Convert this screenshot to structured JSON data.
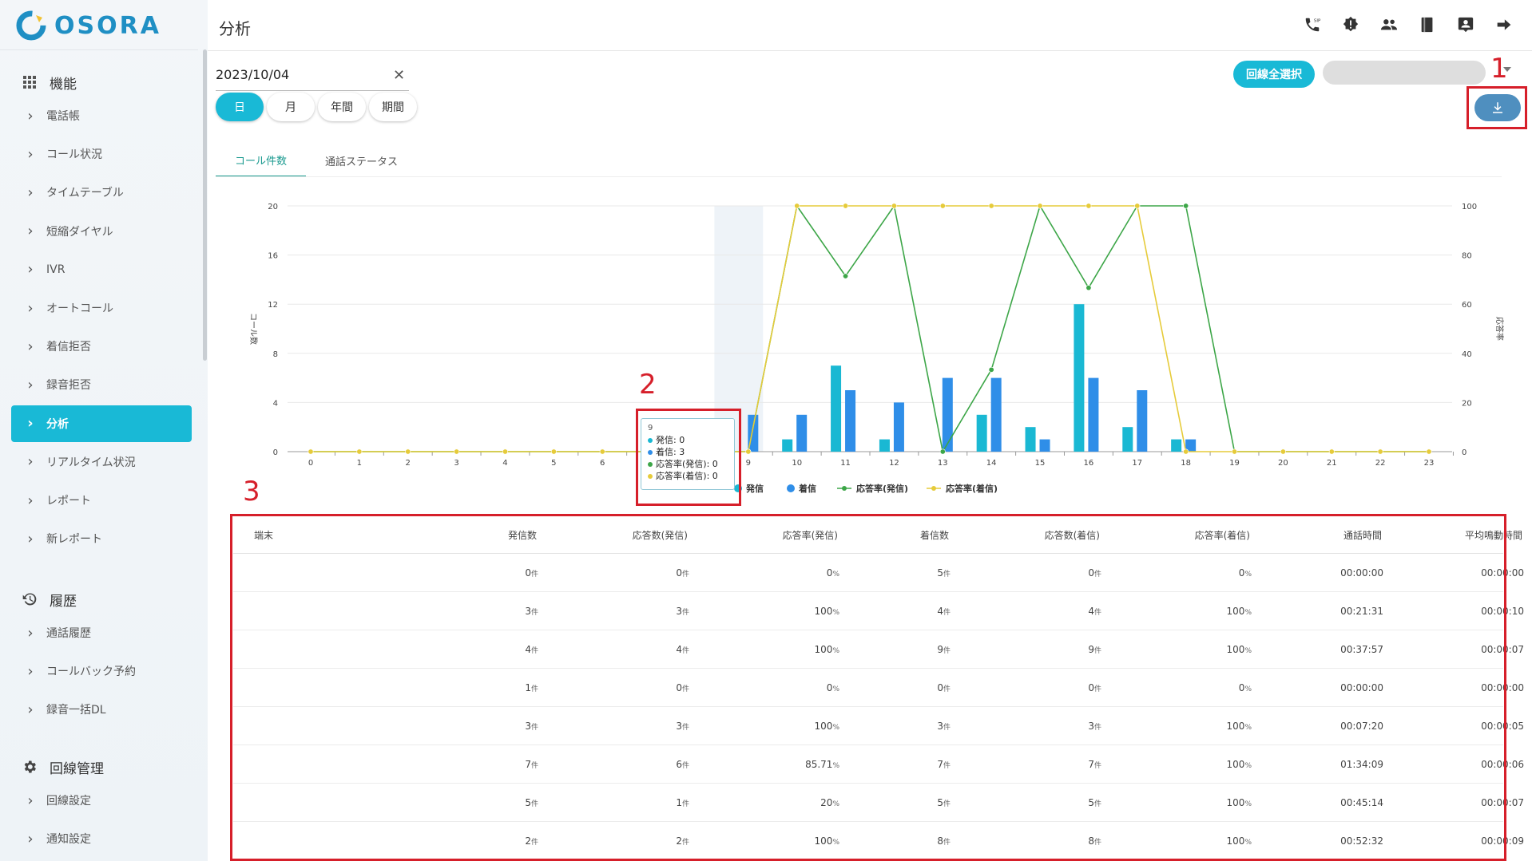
{
  "brand": {
    "name": "OSORA",
    "color": "#1f8fc4",
    "accent": "#19b9d6"
  },
  "header": {
    "title": "分析",
    "icons": [
      "sip-phone-icon",
      "alert-badge-icon",
      "users-icon",
      "book-icon",
      "contact-card-icon",
      "logout-arrow-icon"
    ]
  },
  "sidebar": {
    "sections": [
      {
        "title": "機能",
        "icon": "grid-icon",
        "items": [
          "電話帳",
          "コール状況",
          "タイムテーブル",
          "短縮ダイヤル",
          "IVR",
          "オートコール",
          "着信拒否",
          "録音拒否",
          "分析",
          "リアルタイム状況",
          "レポート",
          "新レポート"
        ]
      },
      {
        "title": "履歴",
        "icon": "history-icon",
        "items": [
          "通話履歴",
          "コールバック予約",
          "録音一括DL"
        ]
      },
      {
        "title": "回線管理",
        "icon": "gear-icon",
        "items": [
          "回線設定",
          "通知設定"
        ]
      }
    ],
    "active_item": "分析"
  },
  "filters": {
    "date": "2023/10/04",
    "periods": [
      "日",
      "月",
      "年間",
      "期間"
    ],
    "active_period": "日",
    "select_all_label": "回線全選択"
  },
  "tabs": {
    "items": [
      "コール件数",
      "通話ステータス"
    ],
    "active": "コール件数"
  },
  "chart_data": {
    "type": "bar",
    "x": [
      0,
      1,
      2,
      3,
      4,
      5,
      6,
      7,
      8,
      9,
      10,
      11,
      12,
      13,
      14,
      15,
      16,
      17,
      18,
      19,
      20,
      21,
      22,
      23
    ],
    "ylabel": "コール数",
    "y2label": "応答率",
    "ylim": [
      0,
      20
    ],
    "y2lim": [
      0,
      100
    ],
    "yticks": [
      0,
      4,
      8,
      12,
      16,
      20
    ],
    "y2ticks": [
      0,
      20,
      40,
      60,
      80,
      100
    ],
    "series": [
      {
        "name": "発信",
        "kind": "bar",
        "color": "#1ab8d3",
        "values": [
          0,
          0,
          0,
          0,
          0,
          0,
          0,
          0,
          0,
          0,
          1,
          7,
          1,
          0,
          3,
          2,
          12,
          2,
          1,
          0,
          0,
          0,
          0,
          0
        ]
      },
      {
        "name": "着信",
        "kind": "bar",
        "color": "#2f8ee8",
        "values": [
          0,
          0,
          0,
          0,
          0,
          0,
          0,
          0,
          0,
          3,
          3,
          5,
          4,
          6,
          6,
          1,
          6,
          5,
          1,
          0,
          0,
          0,
          0,
          0
        ]
      },
      {
        "name": "応答率(発信)",
        "kind": "line",
        "axis": "right",
        "color": "#3da648",
        "values": [
          0,
          0,
          0,
          0,
          0,
          0,
          0,
          0,
          0,
          0,
          100,
          71.43,
          100,
          0,
          33.33,
          100,
          66.67,
          100,
          100,
          0,
          0,
          0,
          0,
          0
        ]
      },
      {
        "name": "応答率(着信)",
        "kind": "line",
        "axis": "right",
        "color": "#e6cb3a",
        "values": [
          0,
          0,
          0,
          0,
          0,
          0,
          0,
          0,
          0,
          0,
          100,
          100,
          100,
          100,
          100,
          100,
          100,
          100,
          0,
          0,
          0,
          0,
          0,
          0
        ]
      }
    ],
    "highlight_x": 9,
    "grid": true,
    "legend": "bottom-center"
  },
  "tooltip": {
    "title": "9",
    "rows": [
      {
        "label": "発信: 0",
        "color": "#1ab8d3"
      },
      {
        "label": "着信: 3",
        "color": "#2f8ee8"
      },
      {
        "label": "応答率(発信): 0",
        "color": "#3da648"
      },
      {
        "label": "応答率(着信): 0",
        "color": "#e6cb3a"
      }
    ]
  },
  "table": {
    "columns": [
      "端末",
      "発信数",
      "応答数(発信)",
      "応答率(発信)",
      "着信数",
      "応答数(着信)",
      "応答率(着信)",
      "通話時間",
      "平均鳴動時間"
    ],
    "rows": [
      [
        "",
        "0",
        "0",
        "0",
        "5",
        "0",
        "0",
        "00:00:00",
        "00:00:00"
      ],
      [
        "",
        "3",
        "3",
        "100",
        "4",
        "4",
        "100",
        "00:21:31",
        "00:00:10"
      ],
      [
        "",
        "4",
        "4",
        "100",
        "9",
        "9",
        "100",
        "00:37:57",
        "00:00:07"
      ],
      [
        "",
        "1",
        "0",
        "0",
        "0",
        "0",
        "0",
        "00:00:00",
        "00:00:00"
      ],
      [
        "",
        "3",
        "3",
        "100",
        "3",
        "3",
        "100",
        "00:07:20",
        "00:00:05"
      ],
      [
        "",
        "7",
        "6",
        "85.71",
        "7",
        "7",
        "100",
        "01:34:09",
        "00:00:06"
      ],
      [
        "",
        "5",
        "1",
        "20",
        "5",
        "5",
        "100",
        "00:45:14",
        "00:00:07"
      ],
      [
        "",
        "2",
        "2",
        "100",
        "8",
        "8",
        "100",
        "00:52:32",
        "00:00:09"
      ]
    ],
    "count_unit": "件",
    "rate_unit": "%"
  },
  "annotations": [
    "1",
    "2",
    "3"
  ],
  "annotation_color": "#d61f2a"
}
